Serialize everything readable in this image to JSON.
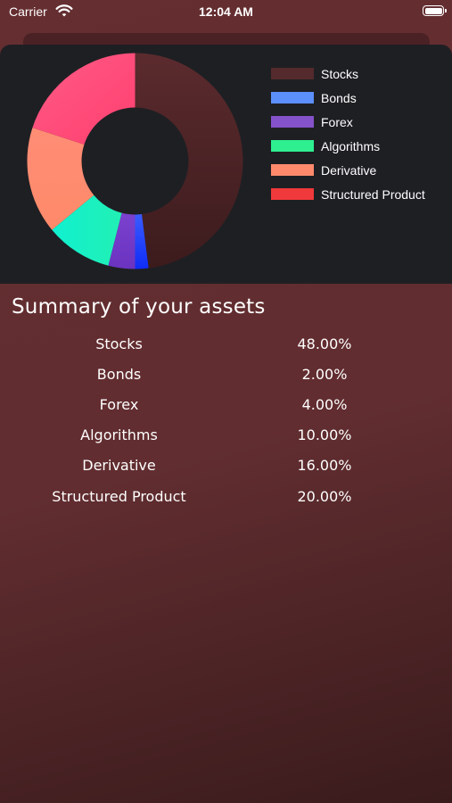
{
  "status_bar": {
    "carrier": "Carrier",
    "time": "12:04 AM"
  },
  "summary": {
    "title": "Summary of your assets",
    "rows": [
      {
        "name": "Stocks",
        "percent": "48.00%"
      },
      {
        "name": "Bonds",
        "percent": "2.00%"
      },
      {
        "name": "Forex",
        "percent": "4.00%"
      },
      {
        "name": "Algorithms",
        "percent": "10.00%"
      },
      {
        "name": "Derivative",
        "percent": "16.00%"
      },
      {
        "name": "Structured Product",
        "percent": "20.00%"
      }
    ]
  },
  "chart_data": {
    "type": "pie",
    "subtype": "donut",
    "legend_position": "right",
    "categories": [
      "Stocks",
      "Bonds",
      "Forex",
      "Algorithms",
      "Derivative",
      "Structured Product"
    ],
    "values": [
      48,
      2,
      4,
      10,
      16,
      20
    ],
    "legend_colors": [
      "#542a2c",
      "#5b8ff9",
      "#8552c9",
      "#2ef091",
      "#ff8a6b",
      "#f0393b"
    ],
    "slice_colors": [
      "#4d2426",
      "#1a3dfb",
      "#7a3bc6",
      "#19f0c2",
      "#ff8c70",
      "#ff4f7e"
    ]
  }
}
